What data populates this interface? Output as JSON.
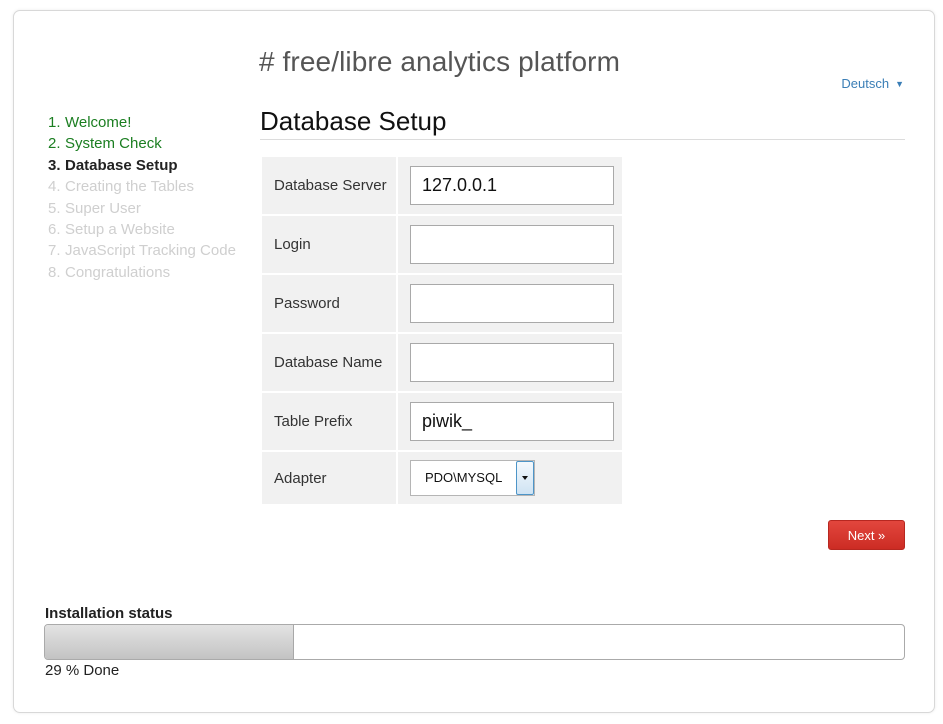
{
  "header": {
    "brand": "# free/libre analytics platform",
    "language": "Deutsch"
  },
  "steps": [
    {
      "num": "1.",
      "label": "Welcome!",
      "state": "done"
    },
    {
      "num": "2.",
      "label": "System Check",
      "state": "done"
    },
    {
      "num": "3.",
      "label": "Database Setup",
      "state": "current"
    },
    {
      "num": "4.",
      "label": "Creating the Tables",
      "state": "todo"
    },
    {
      "num": "5.",
      "label": "Super User",
      "state": "todo"
    },
    {
      "num": "6.",
      "label": "Setup a Website",
      "state": "todo"
    },
    {
      "num": "7.",
      "label": "JavaScript Tracking Code",
      "state": "todo"
    },
    {
      "num": "8.",
      "label": "Congratulations",
      "state": "todo"
    }
  ],
  "main": {
    "title": "Database Setup"
  },
  "form": {
    "server": {
      "label": "Database Server",
      "value": "127.0.0.1"
    },
    "login": {
      "label": "Login",
      "value": ""
    },
    "password": {
      "label": "Password",
      "value": ""
    },
    "dbname": {
      "label": "Database Name",
      "value": ""
    },
    "prefix": {
      "label": "Table Prefix",
      "value": "piwik_"
    },
    "adapter": {
      "label": "Adapter",
      "value": "PDO\\MYSQL"
    }
  },
  "actions": {
    "next": "Next »"
  },
  "status": {
    "title": "Installation status",
    "percent": 29,
    "text": "29 % Done"
  },
  "colors": {
    "done_step": "#1b7e21",
    "todo_step": "#cfcfcf",
    "link": "#3a7eb6",
    "next_button": "#d9372f"
  },
  "icons": {
    "language_caret": "caret-down-icon",
    "select_arrow": "chevron-down-icon"
  }
}
